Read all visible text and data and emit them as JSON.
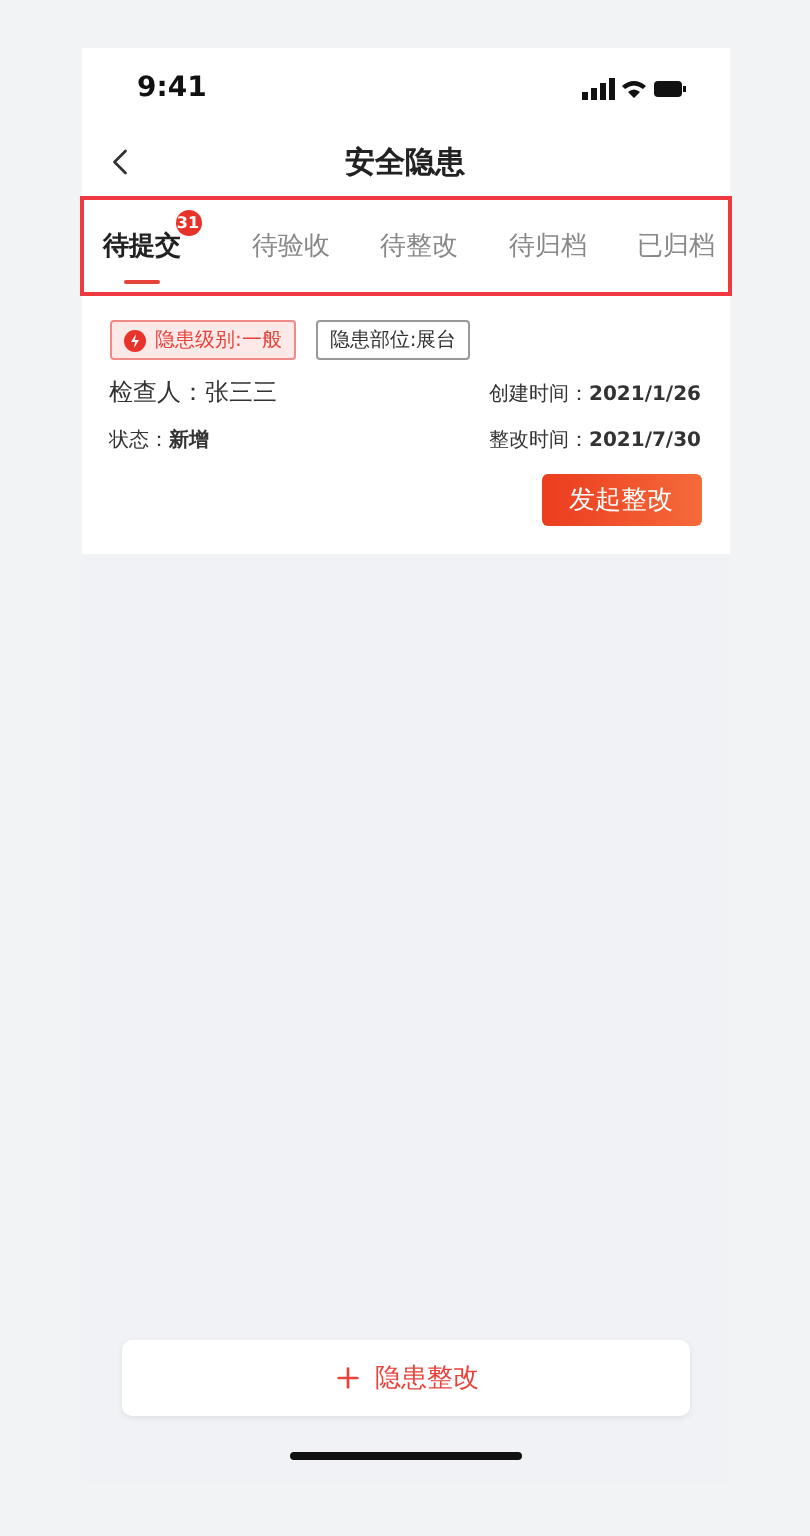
{
  "status_bar": {
    "time": "9:41"
  },
  "nav": {
    "title": "安全隐患"
  },
  "tabs": [
    {
      "label": "待提交",
      "selected": true,
      "badge": "31"
    },
    {
      "label": "待验收",
      "selected": false
    },
    {
      "label": "待整改",
      "selected": false
    },
    {
      "label": "待归档",
      "selected": false
    },
    {
      "label": "已归档",
      "selected": false
    }
  ],
  "record": {
    "tags": [
      {
        "kind": "level",
        "text": "隐患级别:一般"
      },
      {
        "kind": "location",
        "text": "隐患部位:展台"
      }
    ],
    "inspector": {
      "label": "检查人：",
      "value": "张三三"
    },
    "status": {
      "label": "状态：",
      "value": "新增"
    },
    "created": {
      "label": "创建时间：",
      "value": "2021/1/26"
    },
    "deadline": {
      "label": "整改时间：",
      "value": "2021/7/30"
    },
    "action": "发起整改"
  },
  "add_button": "隐患整改"
}
